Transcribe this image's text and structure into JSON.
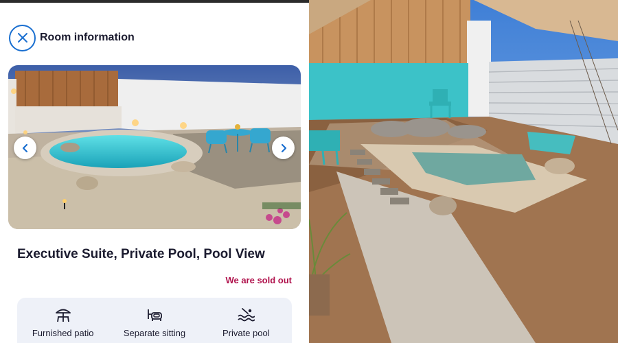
{
  "header": {
    "title": "Room information",
    "close_icon": "close-icon",
    "accent_color": "#1a6fd0"
  },
  "gallery": {
    "prev_icon": "chevron-left-icon",
    "next_icon": "chevron-right-icon"
  },
  "room": {
    "title": "Executive Suite, Private Pool, Pool View",
    "status": "We are sold out",
    "status_color": "#b0124c"
  },
  "amenities": [
    {
      "label": "Furnished patio",
      "icon": "patio-umbrella-icon"
    },
    {
      "label": "Separate sitting",
      "icon": "armchair-icon"
    },
    {
      "label": "Private pool",
      "icon": "pool-waves-icon"
    }
  ]
}
